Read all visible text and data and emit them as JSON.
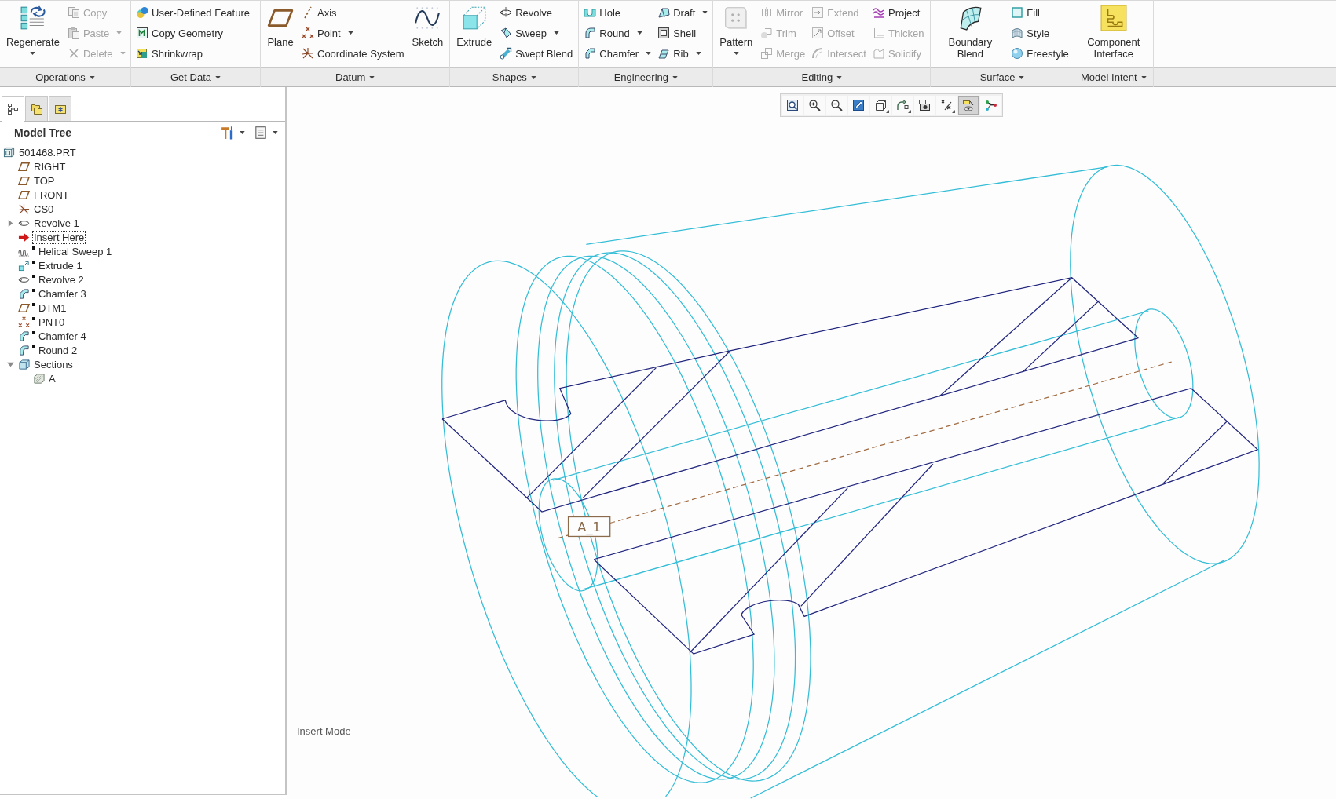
{
  "ribbon": {
    "groups": [
      {
        "label": "Operations",
        "columns": [
          [
            {
              "label": "Regenerate",
              "kind": "large",
              "dropdown": true,
              "disabled": false
            }
          ],
          [
            {
              "label": "Copy",
              "kind": "small",
              "dropdown": false,
              "disabled": true
            },
            {
              "label": "Paste",
              "kind": "small",
              "dropdown": true,
              "disabled": true
            },
            {
              "label": "Delete",
              "kind": "small",
              "dropdown": true,
              "disabled": true
            }
          ]
        ]
      },
      {
        "label": "Get Data",
        "columns": [
          [
            {
              "label": "User-Defined Feature",
              "kind": "small",
              "dropdown": false,
              "disabled": false
            },
            {
              "label": "Copy Geometry",
              "kind": "small",
              "dropdown": false,
              "disabled": false
            },
            {
              "label": "Shrinkwrap",
              "kind": "small",
              "dropdown": false,
              "disabled": false
            }
          ]
        ]
      },
      {
        "label": "Datum",
        "columns": [
          [
            {
              "label": "Plane",
              "kind": "large",
              "dropdown": false,
              "disabled": false
            }
          ],
          [
            {
              "label": "Axis",
              "kind": "small",
              "dropdown": false,
              "disabled": false
            },
            {
              "label": "Point",
              "kind": "small",
              "dropdown": true,
              "disabled": false
            },
            {
              "label": "Coordinate System",
              "kind": "small",
              "dropdown": false,
              "disabled": false
            }
          ],
          [
            {
              "label": "Sketch",
              "kind": "large",
              "dropdown": false,
              "disabled": false
            }
          ]
        ]
      },
      {
        "label": "Shapes",
        "columns": [
          [
            {
              "label": "Extrude",
              "kind": "large",
              "dropdown": false,
              "disabled": false
            }
          ],
          [
            {
              "label": "Revolve",
              "kind": "small",
              "dropdown": false,
              "disabled": false
            },
            {
              "label": "Sweep",
              "kind": "small",
              "dropdown": true,
              "disabled": false
            },
            {
              "label": "Swept Blend",
              "kind": "small",
              "dropdown": false,
              "disabled": false
            }
          ]
        ]
      },
      {
        "label": "Engineering",
        "columns": [
          [
            {
              "label": "Hole",
              "kind": "small",
              "dropdown": false,
              "disabled": false
            },
            {
              "label": "Round",
              "kind": "small",
              "dropdown": true,
              "disabled": false
            },
            {
              "label": "Chamfer",
              "kind": "small",
              "dropdown": true,
              "disabled": false
            }
          ],
          [
            {
              "label": "Draft",
              "kind": "small",
              "dropdown": true,
              "disabled": false
            },
            {
              "label": "Shell",
              "kind": "small",
              "dropdown": false,
              "disabled": false
            },
            {
              "label": "Rib",
              "kind": "small",
              "dropdown": true,
              "disabled": false
            }
          ]
        ]
      },
      {
        "label": "Editing",
        "columns": [
          [
            {
              "label": "Pattern",
              "kind": "large",
              "dropdown": true,
              "disabled": false
            }
          ],
          [
            {
              "label": "Mirror",
              "kind": "small",
              "dropdown": false,
              "disabled": true
            },
            {
              "label": "Trim",
              "kind": "small",
              "dropdown": false,
              "disabled": true
            },
            {
              "label": "Merge",
              "kind": "small",
              "dropdown": false,
              "disabled": true
            }
          ],
          [
            {
              "label": "Extend",
              "kind": "small",
              "dropdown": false,
              "disabled": true
            },
            {
              "label": "Offset",
              "kind": "small",
              "dropdown": false,
              "disabled": true
            },
            {
              "label": "Intersect",
              "kind": "small",
              "dropdown": false,
              "disabled": true
            }
          ],
          [
            {
              "label": "Project",
              "kind": "small",
              "dropdown": false,
              "disabled": false
            },
            {
              "label": "Thicken",
              "kind": "small",
              "dropdown": false,
              "disabled": true
            },
            {
              "label": "Solidify",
              "kind": "small",
              "dropdown": false,
              "disabled": true
            }
          ]
        ]
      },
      {
        "label": "Surface",
        "columns": [
          [
            {
              "label": "Boundary Blend",
              "kind": "large",
              "dropdown": false,
              "disabled": false
            }
          ],
          [
            {
              "label": "Fill",
              "kind": "small",
              "dropdown": false,
              "disabled": false
            },
            {
              "label": "Style",
              "kind": "small",
              "dropdown": false,
              "disabled": false
            },
            {
              "label": "Freestyle",
              "kind": "small",
              "dropdown": false,
              "disabled": false
            }
          ]
        ]
      },
      {
        "label": "Model Intent",
        "columns": [
          [
            {
              "label": "Component Interface",
              "kind": "large",
              "dropdown": false,
              "disabled": false
            }
          ]
        ]
      }
    ]
  },
  "side_panel": {
    "tabs": [
      {
        "selected": true
      },
      {
        "selected": false
      },
      {
        "selected": false
      }
    ],
    "title": "Model Tree",
    "tree": [
      {
        "label": "501468.PRT",
        "kind": "part",
        "selected": false,
        "inactive": false,
        "children": [
          {
            "label": "RIGHT",
            "kind": "plane",
            "selected": false,
            "inactive": false
          },
          {
            "label": "TOP",
            "kind": "plane",
            "selected": false,
            "inactive": false
          },
          {
            "label": "FRONT",
            "kind": "plane",
            "selected": false,
            "inactive": false
          },
          {
            "label": "CS0",
            "kind": "csys",
            "selected": false,
            "inactive": false
          },
          {
            "label": "Revolve 1",
            "kind": "revolve",
            "selected": false,
            "inactive": false,
            "expanded": false
          },
          {
            "label": "Insert Here",
            "kind": "insert",
            "selected": true,
            "inactive": false
          },
          {
            "label": "Helical Sweep 1",
            "kind": "helical-sweep",
            "selected": false,
            "inactive": true
          },
          {
            "label": "Extrude 1",
            "kind": "extrude",
            "selected": false,
            "inactive": true
          },
          {
            "label": "Revolve 2",
            "kind": "revolve",
            "selected": false,
            "inactive": true
          },
          {
            "label": "Chamfer 3",
            "kind": "chamfer",
            "selected": false,
            "inactive": true
          },
          {
            "label": "DTM1",
            "kind": "plane",
            "selected": false,
            "inactive": true
          },
          {
            "label": "PNT0",
            "kind": "point",
            "selected": false,
            "inactive": true
          },
          {
            "label": "Chamfer 4",
            "kind": "chamfer",
            "selected": false,
            "inactive": true
          },
          {
            "label": "Round 2",
            "kind": "round",
            "selected": false,
            "inactive": true
          },
          {
            "label": "Sections",
            "kind": "folder",
            "selected": false,
            "inactive": false,
            "expanded": true,
            "children": [
              {
                "label": "A",
                "kind": "section",
                "selected": false,
                "inactive": false
              }
            ]
          }
        ]
      }
    ]
  },
  "view_toolbar": [
    {
      "on": false,
      "dropdown": false
    },
    {
      "on": false,
      "dropdown": false
    },
    {
      "on": false,
      "dropdown": false
    },
    {
      "on": false,
      "dropdown": false
    },
    {
      "on": false,
      "dropdown": true
    },
    {
      "on": false,
      "dropdown": true
    },
    {
      "on": false,
      "dropdown": false
    },
    {
      "on": false,
      "dropdown": true
    },
    {
      "on": true,
      "dropdown": false
    },
    {
      "on": false,
      "dropdown": false
    }
  ],
  "graphics": {
    "axis_label": "A_1",
    "status": "Insert Mode"
  }
}
